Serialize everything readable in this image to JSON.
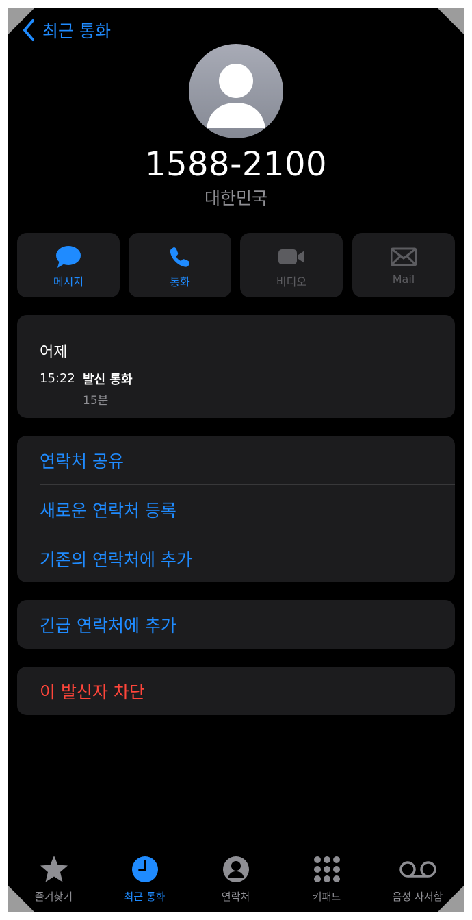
{
  "nav": {
    "back_label": "최근 통화"
  },
  "contact": {
    "number": "1588-2100",
    "country": "대한민국"
  },
  "actions": [
    {
      "label": "메시지",
      "icon": "message-icon",
      "enabled": true
    },
    {
      "label": "통화",
      "icon": "phone-icon",
      "enabled": true
    },
    {
      "label": "비디오",
      "icon": "video-icon",
      "enabled": false
    },
    {
      "label": "Mail",
      "icon": "mail-icon",
      "enabled": false
    }
  ],
  "history": {
    "date": "어제",
    "time": "15:22",
    "type": "발신 통화",
    "duration": "15분"
  },
  "options": [
    "연락처 공유",
    "새로운 연락처 등록",
    "기존의 연락처에 추가"
  ],
  "emergency": "긴급 연락처에 추가",
  "block": "이 발신자 차단",
  "tabs": [
    {
      "label": "즐겨찾기",
      "icon": "star-icon",
      "active": false
    },
    {
      "label": "최근 통화",
      "icon": "clock-icon",
      "active": true
    },
    {
      "label": "연락처",
      "icon": "person-circle-icon",
      "active": false
    },
    {
      "label": "키패드",
      "icon": "keypad-icon",
      "active": false
    },
    {
      "label": "음성 사서함",
      "icon": "voicemail-icon",
      "active": false
    }
  ],
  "colors": {
    "accent": "#1f8bff",
    "destructive": "#ff453a",
    "card": "#1c1c1e",
    "secondary_text": "#8e8e93"
  }
}
